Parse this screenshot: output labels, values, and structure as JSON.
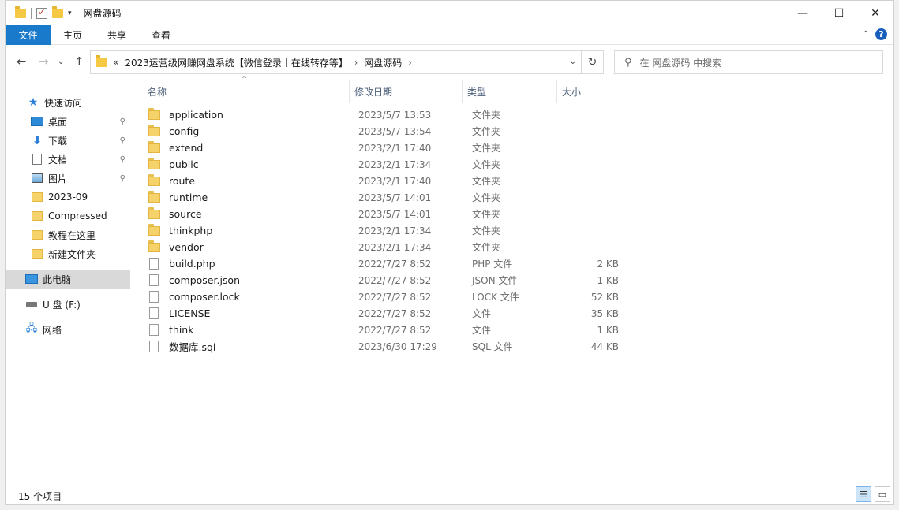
{
  "titlebar": {
    "title": "网盘源码",
    "minimize": "—",
    "maximize": "☐",
    "close": "✕"
  },
  "ribbon": {
    "tabs": [
      "文件",
      "主页",
      "共享",
      "查看"
    ],
    "help": "?",
    "collapse": "⌃"
  },
  "nav": {
    "back": "←",
    "forward": "→",
    "recent": "⌄",
    "up": "↑",
    "breadcrumb_prefix": "«",
    "crumbs": [
      "2023运营级网赚网盘系统【微信登录丨在线转存等】",
      "网盘源码"
    ],
    "crumb_sep": "›",
    "dropdown": "⌄",
    "refresh": "↻",
    "search_placeholder": "在 网盘源码 中搜索"
  },
  "sidebar": {
    "items": [
      {
        "label": "快速访问",
        "icon": "star-icon"
      },
      {
        "label": "桌面",
        "icon": "desktop-icon",
        "pinned": true
      },
      {
        "label": "下载",
        "icon": "download-icon",
        "pinned": true
      },
      {
        "label": "文档",
        "icon": "document-icon",
        "pinned": true
      },
      {
        "label": "图片",
        "icon": "picture-icon",
        "pinned": true
      },
      {
        "label": "2023-09",
        "icon": "folder-icon"
      },
      {
        "label": "Compressed",
        "icon": "folder-icon"
      },
      {
        "label": "教程在这里",
        "icon": "folder-icon"
      },
      {
        "label": "新建文件夹",
        "icon": "folder-icon"
      },
      {
        "label": "此电脑",
        "icon": "computer-icon",
        "selected": true
      },
      {
        "label": "U 盘 (F:)",
        "icon": "usb-drive-icon"
      },
      {
        "label": "网络",
        "icon": "network-icon"
      }
    ],
    "pin_glyph": "📌"
  },
  "columns": {
    "name": "名称",
    "date": "修改日期",
    "type": "类型",
    "size": "大小"
  },
  "files": [
    {
      "name": "application",
      "date": "2023/5/7 13:53",
      "type": "文件夹",
      "size": "",
      "kind": "folder"
    },
    {
      "name": "config",
      "date": "2023/5/7 13:54",
      "type": "文件夹",
      "size": "",
      "kind": "folder"
    },
    {
      "name": "extend",
      "date": "2023/2/1 17:40",
      "type": "文件夹",
      "size": "",
      "kind": "folder"
    },
    {
      "name": "public",
      "date": "2023/2/1 17:34",
      "type": "文件夹",
      "size": "",
      "kind": "folder"
    },
    {
      "name": "route",
      "date": "2023/2/1 17:40",
      "type": "文件夹",
      "size": "",
      "kind": "folder"
    },
    {
      "name": "runtime",
      "date": "2023/5/7 14:01",
      "type": "文件夹",
      "size": "",
      "kind": "folder"
    },
    {
      "name": "source",
      "date": "2023/5/7 14:01",
      "type": "文件夹",
      "size": "",
      "kind": "folder"
    },
    {
      "name": "thinkphp",
      "date": "2023/2/1 17:34",
      "type": "文件夹",
      "size": "",
      "kind": "folder"
    },
    {
      "name": "vendor",
      "date": "2023/2/1 17:34",
      "type": "文件夹",
      "size": "",
      "kind": "folder"
    },
    {
      "name": "build.php",
      "date": "2022/7/27 8:52",
      "type": "PHP 文件",
      "size": "2 KB",
      "kind": "file"
    },
    {
      "name": "composer.json",
      "date": "2022/7/27 8:52",
      "type": "JSON 文件",
      "size": "1 KB",
      "kind": "file"
    },
    {
      "name": "composer.lock",
      "date": "2022/7/27 8:52",
      "type": "LOCK 文件",
      "size": "52 KB",
      "kind": "file"
    },
    {
      "name": "LICENSE",
      "date": "2022/7/27 8:52",
      "type": "文件",
      "size": "35 KB",
      "kind": "file"
    },
    {
      "name": "think",
      "date": "2022/7/27 8:52",
      "type": "文件",
      "size": "1 KB",
      "kind": "file"
    },
    {
      "name": "数据库.sql",
      "date": "2023/6/30 17:29",
      "type": "SQL 文件",
      "size": "44 KB",
      "kind": "file"
    }
  ],
  "status": {
    "count": "15 个项目"
  }
}
